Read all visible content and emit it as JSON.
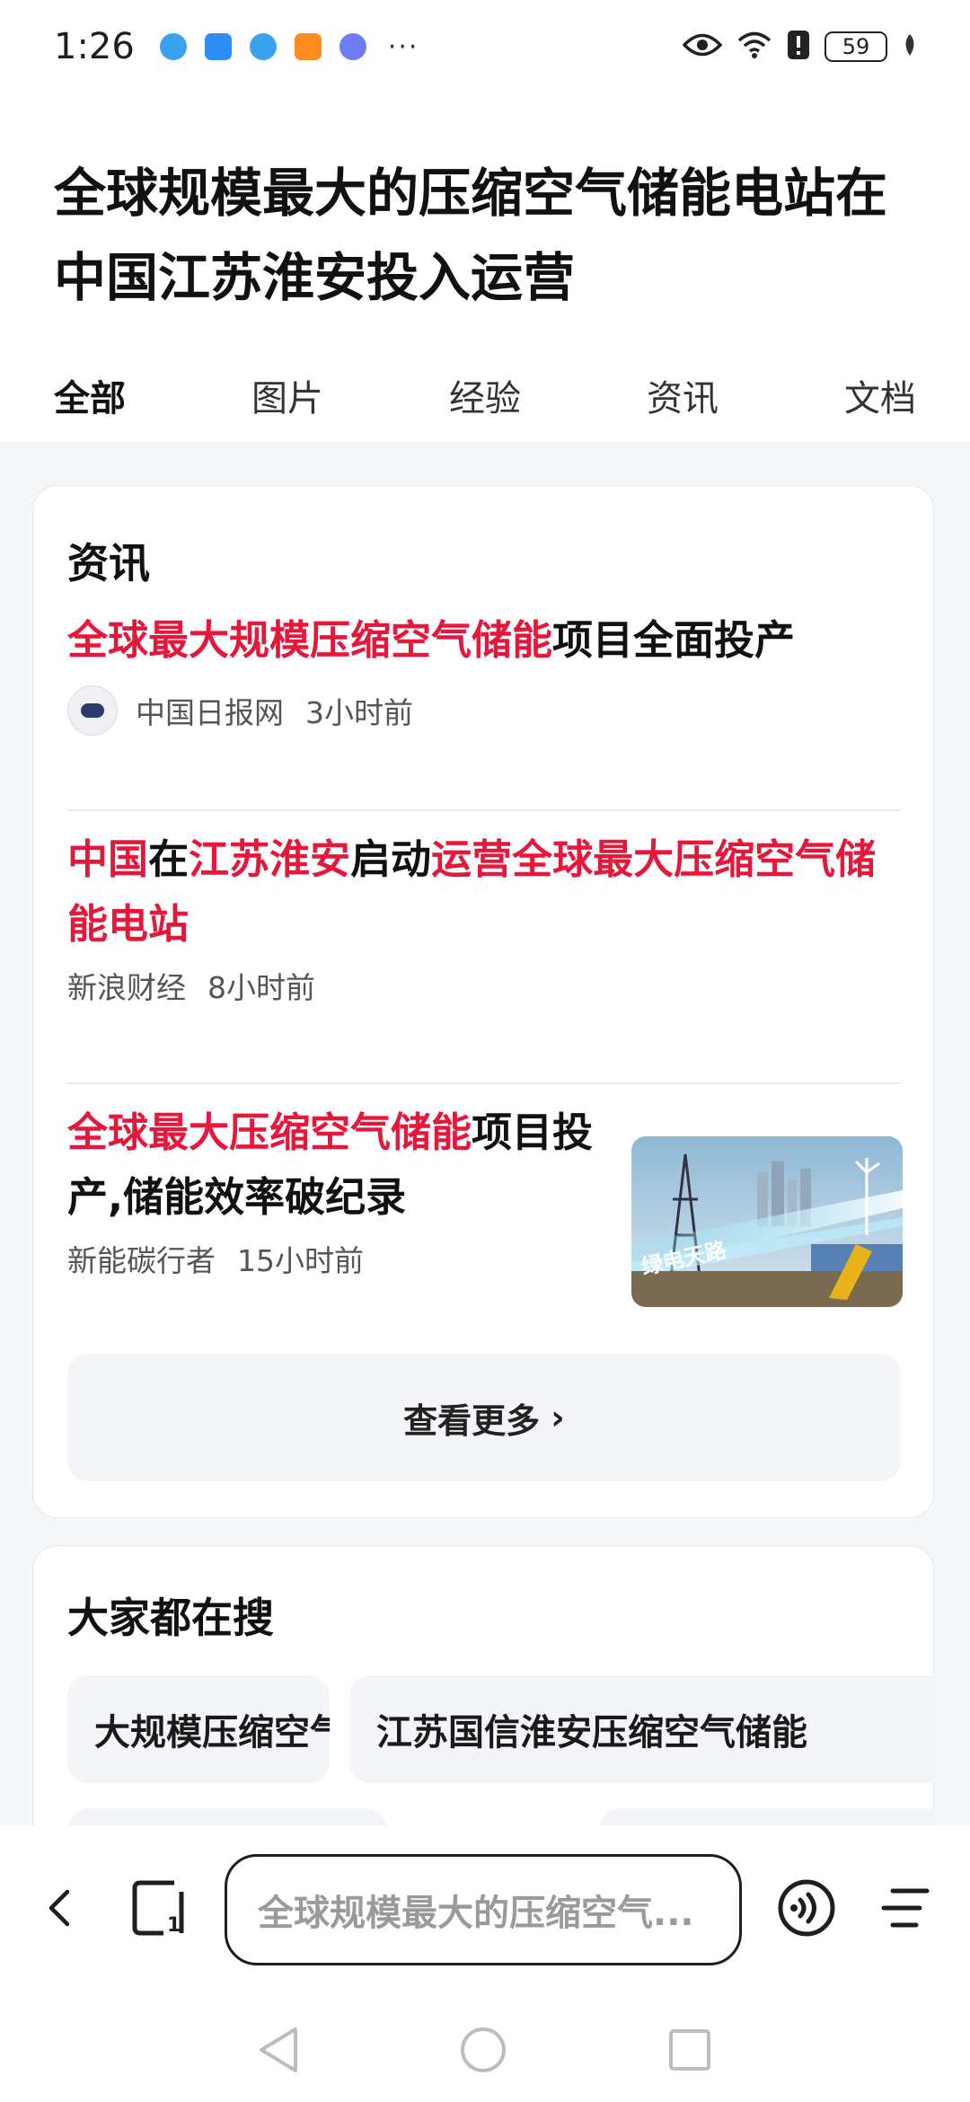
{
  "status_bar": {
    "time": "1:26",
    "more_indicator": "···",
    "battery_level": "59",
    "notification_icons": [
      "browser-icon",
      "weather-icon",
      "browser-icon",
      "video-icon",
      "music-icon"
    ],
    "system_icons": [
      "eye-icon",
      "wifi-icon",
      "alert-icon",
      "battery-icon",
      "leaf-icon"
    ]
  },
  "page": {
    "title": "全球规模最大的压缩空气储能电站在中国江苏淮安投入运营"
  },
  "tabs": [
    {
      "label": "全部",
      "active": true
    },
    {
      "label": "图片",
      "active": false
    },
    {
      "label": "经验",
      "active": false
    },
    {
      "label": "资讯",
      "active": false
    },
    {
      "label": "文档",
      "active": false
    }
  ],
  "news_card": {
    "heading": "资讯",
    "items": [
      {
        "title_parts": [
          {
            "text": "全球最大规模压缩空气储能",
            "highlight": true
          },
          {
            "text": "项目全面投产",
            "highlight": false
          }
        ],
        "source": "中国日报网",
        "time": "3小时前"
      },
      {
        "title_parts": [
          {
            "text": "中国",
            "highlight": true
          },
          {
            "text": "在",
            "highlight": false
          },
          {
            "text": "江苏淮安",
            "highlight": true
          },
          {
            "text": "启动",
            "highlight": false
          },
          {
            "text": "运营全球最大压缩空气储能电站",
            "highlight": true
          }
        ],
        "source": "新浪财经",
        "time": "8小时前"
      },
      {
        "title_parts": [
          {
            "text": "全球最大压缩空气储能",
            "highlight": true
          },
          {
            "text": "项目投产,储能效率破纪录",
            "highlight": false
          }
        ],
        "source": "新能碳行者",
        "time": "15小时前",
        "thumbnail_caption": "绿电天路"
      }
    ],
    "more_label": "查看更多"
  },
  "search_card": {
    "heading": "大家都在搜",
    "chips": [
      "大规模压缩空气储能",
      "江苏国信淮安压缩空气储能"
    ]
  },
  "bottom_bar": {
    "search_text": "全球规模最大的压缩空气..."
  },
  "colors": {
    "highlight": "#e5173a",
    "accent": "#3a6cf0",
    "background_gray": "#f5f6f8"
  }
}
